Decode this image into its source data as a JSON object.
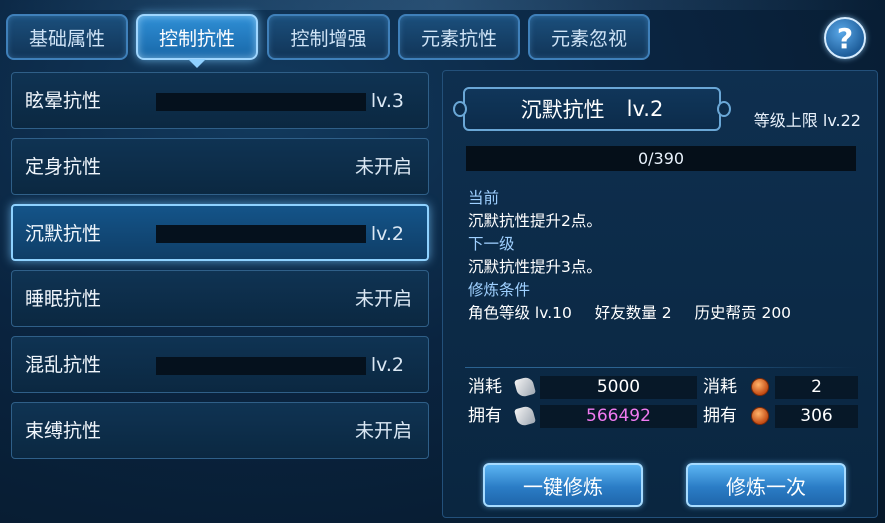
{
  "tabs": [
    {
      "label": "基础属性",
      "active": false
    },
    {
      "label": "控制抗性",
      "active": true
    },
    {
      "label": "控制增强",
      "active": false
    },
    {
      "label": "元素抗性",
      "active": false
    },
    {
      "label": "元素忽视",
      "active": false
    }
  ],
  "help_label": "?",
  "resistances": [
    {
      "name": "眩晕抗性",
      "status": "lv.3",
      "unlocked": true
    },
    {
      "name": "定身抗性",
      "status": "未开启",
      "unlocked": false
    },
    {
      "name": "沉默抗性",
      "status": "lv.2",
      "unlocked": true,
      "selected": true
    },
    {
      "name": "睡眠抗性",
      "status": "未开启",
      "unlocked": false
    },
    {
      "name": "混乱抗性",
      "status": "lv.2",
      "unlocked": true
    },
    {
      "name": "束缚抗性",
      "status": "未开启",
      "unlocked": false
    }
  ],
  "detail": {
    "title": "沉默抗性",
    "level": "lv.2",
    "level_cap": "等级上限 lv.22",
    "progress_text": "0/390",
    "current_label": "当前",
    "current_text": "沉默抗性提升2点。",
    "next_label": "下一级",
    "next_text": "沉默抗性提升3点。",
    "conditions_label": "修炼条件",
    "conditions": [
      "角色等级 lv.10",
      "好友数量 2",
      "历史帮贡 200"
    ]
  },
  "costs": {
    "consume_label": "消耗",
    "own_label": "拥有",
    "scroll_consume": "5000",
    "scroll_own": "566492",
    "coin_consume": "2",
    "coin_own": "306"
  },
  "buttons": {
    "train_all": "一键修炼",
    "train_once": "修炼一次"
  },
  "colors": {
    "highlight_pink": "#f07af0",
    "label_blue": "#9fd0ff"
  }
}
